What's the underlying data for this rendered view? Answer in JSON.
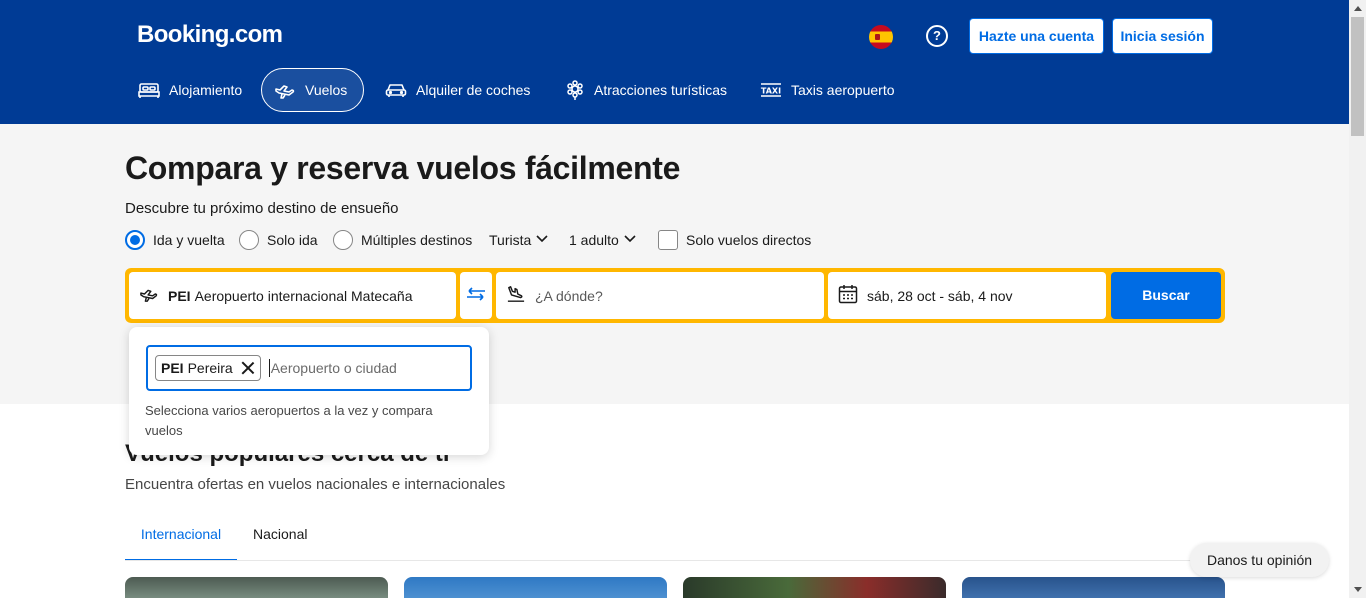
{
  "header": {
    "logo": "Booking.com",
    "language_icon": "spain-flag-icon",
    "help_label": "?",
    "register_label": "Hazte una cuenta",
    "login_label": "Inicia sesión"
  },
  "nav": [
    {
      "label": "Alojamiento",
      "icon": "bed-icon",
      "active": false
    },
    {
      "label": "Vuelos",
      "icon": "plane-icon",
      "active": true
    },
    {
      "label": "Alquiler de coches",
      "icon": "car-icon",
      "active": false
    },
    {
      "label": "Atracciones turísticas",
      "icon": "attractions-icon",
      "active": false
    },
    {
      "label": "Taxis aeropuerto",
      "icon": "taxi-icon",
      "active": false
    }
  ],
  "hero": {
    "title": "Compara y reserva vuelos fácilmente",
    "subtitle": "Descubre tu próximo destino de ensueño"
  },
  "trip_options": {
    "round_trip": "Ida y vuelta",
    "one_way": "Solo ida",
    "multi_city": "Múltiples destinos",
    "selected": "Ida y vuelta",
    "cabin_class": "Turista",
    "passengers": "1 adulto",
    "direct_only": "Solo vuelos directos",
    "direct_only_checked": false
  },
  "search": {
    "from_code": "PEI",
    "from_name": "Aeropuerto internacional Matecaña",
    "to_placeholder": "¿A dónde?",
    "dates": "sáb, 28 oct - sáb, 4 nov",
    "submit_label": "Buscar"
  },
  "popup": {
    "chip_code": "PEI",
    "chip_city": "Pereira",
    "input_placeholder": "Aeropuerto o ciudad",
    "hint": "Selecciona varios aeropuertos a la vez y compara vuelos"
  },
  "popular": {
    "title": "Vuelos populares cerca de ti",
    "subtitle": "Encuentra ofertas en vuelos nacionales e internacionales",
    "tabs": [
      "Internacional",
      "Nacional"
    ],
    "active_tab": "Internacional"
  },
  "feedback_label": "Danos tu opinión",
  "colors": {
    "brand_blue": "#003b95",
    "action_blue": "#006ce4",
    "search_border": "#ffb700"
  }
}
